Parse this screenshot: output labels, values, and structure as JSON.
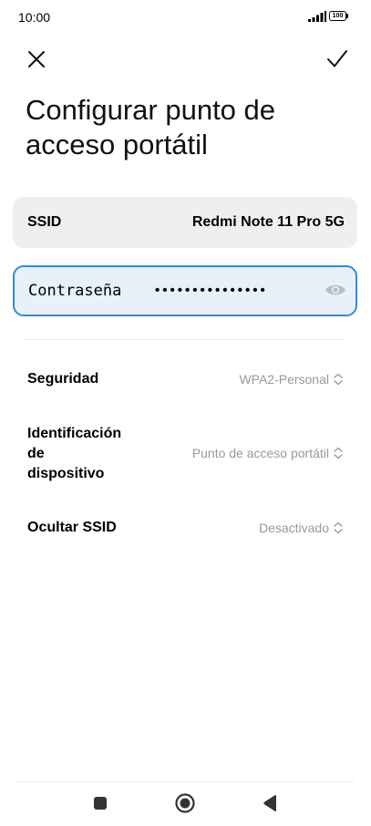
{
  "status_bar": {
    "time": "10:00",
    "battery": "100",
    "icons": [
      "signal-icon",
      "battery-icon"
    ]
  },
  "toolbar": {
    "close_icon": "close-icon",
    "confirm_icon": "check-icon"
  },
  "page": {
    "title": "Configurar punto de acceso portátil"
  },
  "ssid": {
    "label": "SSID",
    "value": "Redmi Note 11 Pro 5G"
  },
  "password": {
    "label": "Contraseña",
    "value": "•••••••••••••••",
    "toggle_icon": "eye-icon"
  },
  "settings": [
    {
      "label": "Seguridad",
      "value": "WPA2-Personal"
    },
    {
      "label": "Identificación de dispositivo",
      "label_lines": [
        "Identificación",
        "de",
        "dispositivo"
      ],
      "value": "Punto de acceso portátil"
    },
    {
      "label": "Ocultar SSID",
      "value": "Desactivado"
    }
  ],
  "nav_bar": {
    "icons": [
      "recents-icon",
      "home-icon",
      "back-icon"
    ]
  },
  "colors": {
    "accent": "#2f8de4",
    "field_bg": "#efefef",
    "focused_field_bg": "#e8f1f9",
    "secondary_text": "#999999"
  }
}
